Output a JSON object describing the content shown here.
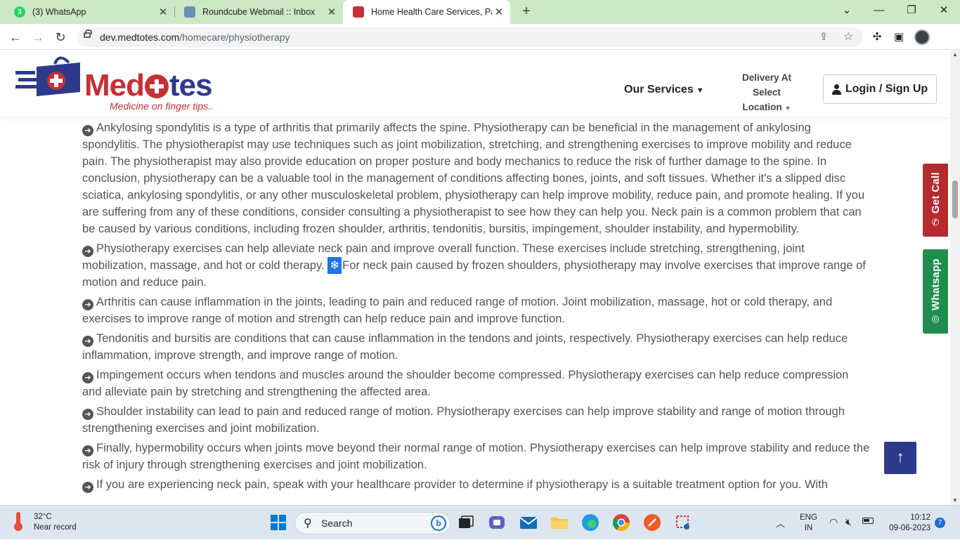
{
  "browser": {
    "tabs": [
      {
        "title": "(3) WhatsApp",
        "icon": "whatsapp-icon",
        "badge": "3"
      },
      {
        "title": "Roundcube Webmail :: Inbox",
        "icon": "roundcube-icon"
      },
      {
        "title": "Home Health Care Services, Pack",
        "icon": "medtotes-icon"
      }
    ],
    "url_domain": "dev.medtotes.com",
    "url_path": "/homecare/physiotherapy"
  },
  "site": {
    "logo_part1": "Med",
    "logo_part2": "tes",
    "tagline": "Medicine on finger tips..",
    "nav": {
      "services": "Our Services",
      "delivery_label": "Delivery At",
      "location": "Select Location",
      "login": "Login / Sign Up"
    },
    "side_buttons": {
      "call": "Get Call",
      "whatsapp": "Whatsapp"
    },
    "selected_glyph": "❄"
  },
  "content": {
    "paragraphs": [
      "Ankylosing spondylitis is a type of arthritis that primarily affects the spine. Physiotherapy can be beneficial in the management of ankylosing spondylitis. The physiotherapist may use techniques such as joint mobilization, stretching, and strengthening exercises to improve mobility and reduce pain. The physiotherapist may also provide education on proper posture and body mechanics to reduce the risk of further damage to the spine. In conclusion, physiotherapy can be a valuable tool in the management of conditions affecting bones, joints, and soft tissues. Whether it's a slipped disc sciatica, ankylosing spondylitis, or any other musculoskeletal problem, physiotherapy can help improve mobility, reduce pain, and promote healing. If you are suffering from any of these conditions, consider consulting a physiotherapist to see how they can help you. Neck pain is a common problem that can be caused by various conditions, including frozen shoulder, arthritis, tendonitis, bursitis, impingement, shoulder instability, and hypermobility.",
      "Physiotherapy exercises can help alleviate neck pain and improve overall function. These exercises include stretching, strengthening, joint mobilization, massage, and hot or cold therapy.",
      "For neck pain caused by frozen shoulders, physiotherapy may involve exercises that improve range of motion and reduce pain.",
      "Arthritis can cause inflammation in the joints, leading to pain and reduced range of motion. Joint mobilization, massage, hot or cold therapy, and exercises to improve range of motion and strength can help reduce pain and improve function.",
      "Tendonitis and bursitis are conditions that can cause inflammation in the tendons and joints, respectively. Physiotherapy exercises can help reduce inflammation, improve strength, and improve range of motion.",
      "Impingement occurs when tendons and muscles around the shoulder become compressed. Physiotherapy exercises can help reduce compression and alleviate pain by stretching and strengthening the affected area.",
      "Shoulder instability can lead to pain and reduced range of motion. Physiotherapy exercises can help improve stability and range of motion through strengthening exercises and joint mobilization.",
      "Finally, hypermobility occurs when joints move beyond their normal range of motion. Physiotherapy exercises can help improve stability and reduce the risk of injury through strengthening exercises and joint mobilization.",
      "If you are experiencing neck pain, speak with your healthcare provider to determine if physiotherapy is a suitable treatment option for you. With"
    ]
  },
  "taskbar": {
    "weather_temp": "32°C",
    "weather_desc": "Near record",
    "search": "Search",
    "lang1": "ENG",
    "lang2": "IN",
    "time": "10:12",
    "date": "09-06-2023",
    "notifications": "7"
  },
  "colors": {
    "brand_red": "#c62f34",
    "brand_blue": "#2d3a8c",
    "whatsapp_green": "#1e8e4e",
    "tab_strip": "#cde8c5"
  }
}
